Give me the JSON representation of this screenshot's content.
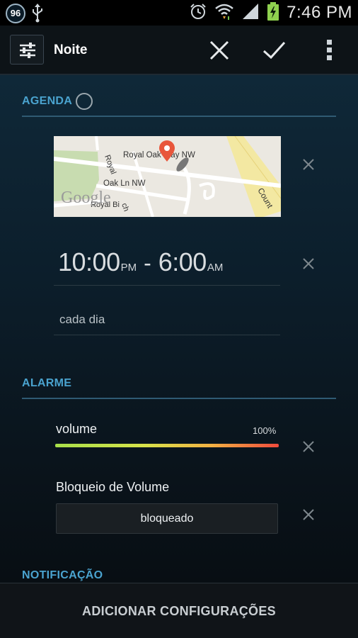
{
  "status_bar": {
    "badge_count": "96",
    "time": "7:46 PM",
    "icons": [
      "usb-icon",
      "alarm-icon",
      "wifi-icon",
      "signal-icon",
      "battery-charging-icon"
    ]
  },
  "action_bar": {
    "title": "Noite",
    "icons": [
      "settings-sliders-icon",
      "close-icon",
      "check-icon",
      "overflow-menu-icon"
    ]
  },
  "agenda": {
    "header": "AGENDA",
    "map": {
      "logo": "Google",
      "streets": [
        "Royal Oak Way NW",
        "Oak Ln NW",
        "Royal",
        "Royal Bi",
        "ch",
        "Count"
      ]
    },
    "time_start": "10:00",
    "time_start_ampm": "PM",
    "time_separator": "-",
    "time_end": "6:00",
    "time_end_ampm": "AM",
    "repeat": "cada dia"
  },
  "alarme": {
    "header": "ALARME",
    "volume_label": "volume",
    "volume_percent": "100%",
    "volume_level": 1.0,
    "lock_label": "Bloqueio de Volume",
    "lock_value": "bloqueado"
  },
  "notificacao": {
    "header": "NOTIFICAÇÃO"
  },
  "bottom": {
    "button_label": "ADICIONAR CONFIGURAÇÕES"
  },
  "colors": {
    "accent": "#4aa3cf",
    "section_line": "#2f5a73",
    "map_pin": "#e8563b"
  }
}
